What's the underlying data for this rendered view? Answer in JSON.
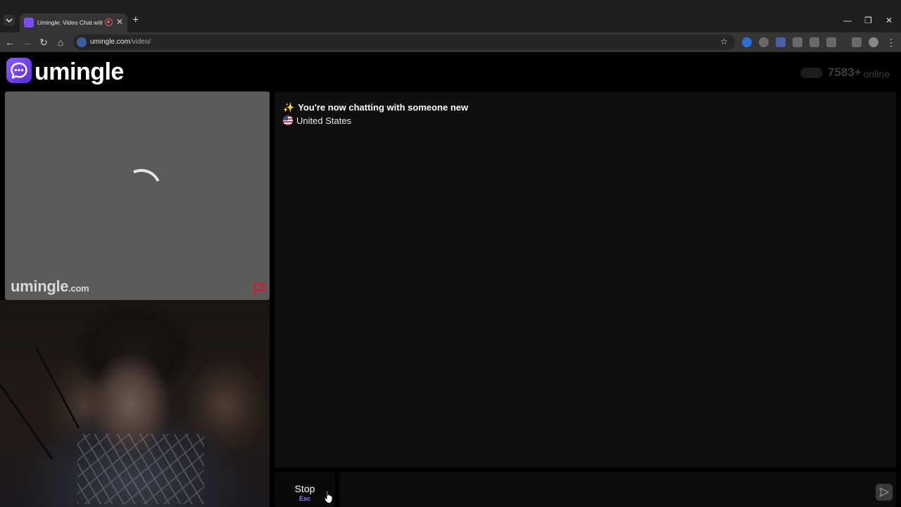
{
  "browser": {
    "tab_title": "Umingle: Video Chat with Strangers",
    "url_domain": "umingle.com",
    "url_path": "/video/",
    "new_tab": "+",
    "tab_close": "✕",
    "window": {
      "minimize": "—",
      "restore": "❐",
      "close": "✕"
    }
  },
  "header": {
    "logo_text": "umingle",
    "online_count": "7583+",
    "online_label": "online"
  },
  "remote_video": {
    "watermark": "umingle",
    "watermark_suffix": ".com"
  },
  "chat": {
    "status_icon": "✨",
    "status_message": "You're now chatting with someone new",
    "country": "United States"
  },
  "controls": {
    "stop_label": "Stop",
    "stop_shortcut": "Esc",
    "message_placeholder": ""
  },
  "colors": {
    "brand": "#7b4dff",
    "shortcut_accent": "#8f7bff",
    "report_flag": "#d11a2a"
  }
}
